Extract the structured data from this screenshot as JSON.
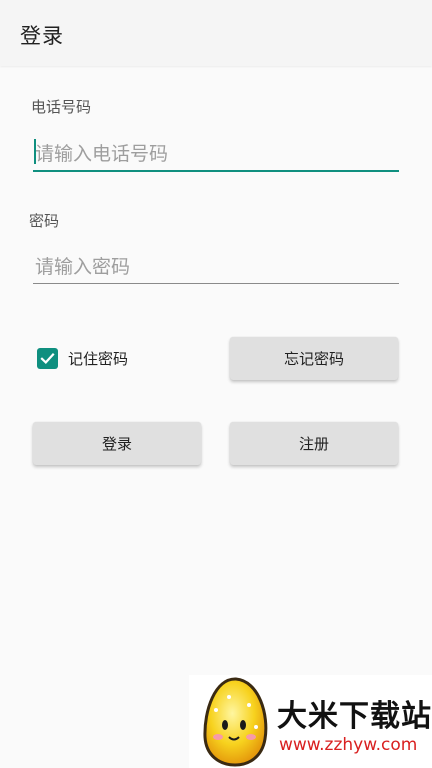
{
  "appbar": {
    "title": "登录"
  },
  "form": {
    "phone": {
      "label": "电话号码",
      "placeholder": "请输入电话号码",
      "value": ""
    },
    "password": {
      "label": "密码",
      "placeholder": "请输入密码",
      "value": ""
    },
    "remember": {
      "label": "记住密码",
      "checked": true
    },
    "forgot_label": "忘记密码",
    "login_label": "登录",
    "register_label": "注册"
  },
  "watermark": {
    "name": "大米下载站",
    "url": "www.zzhyw.com"
  },
  "colors": {
    "accent": "#0f8f7f",
    "appbar_bg": "#f5f5f5",
    "button_bg": "#e0e0e0",
    "watermark_url": "#d92020"
  }
}
